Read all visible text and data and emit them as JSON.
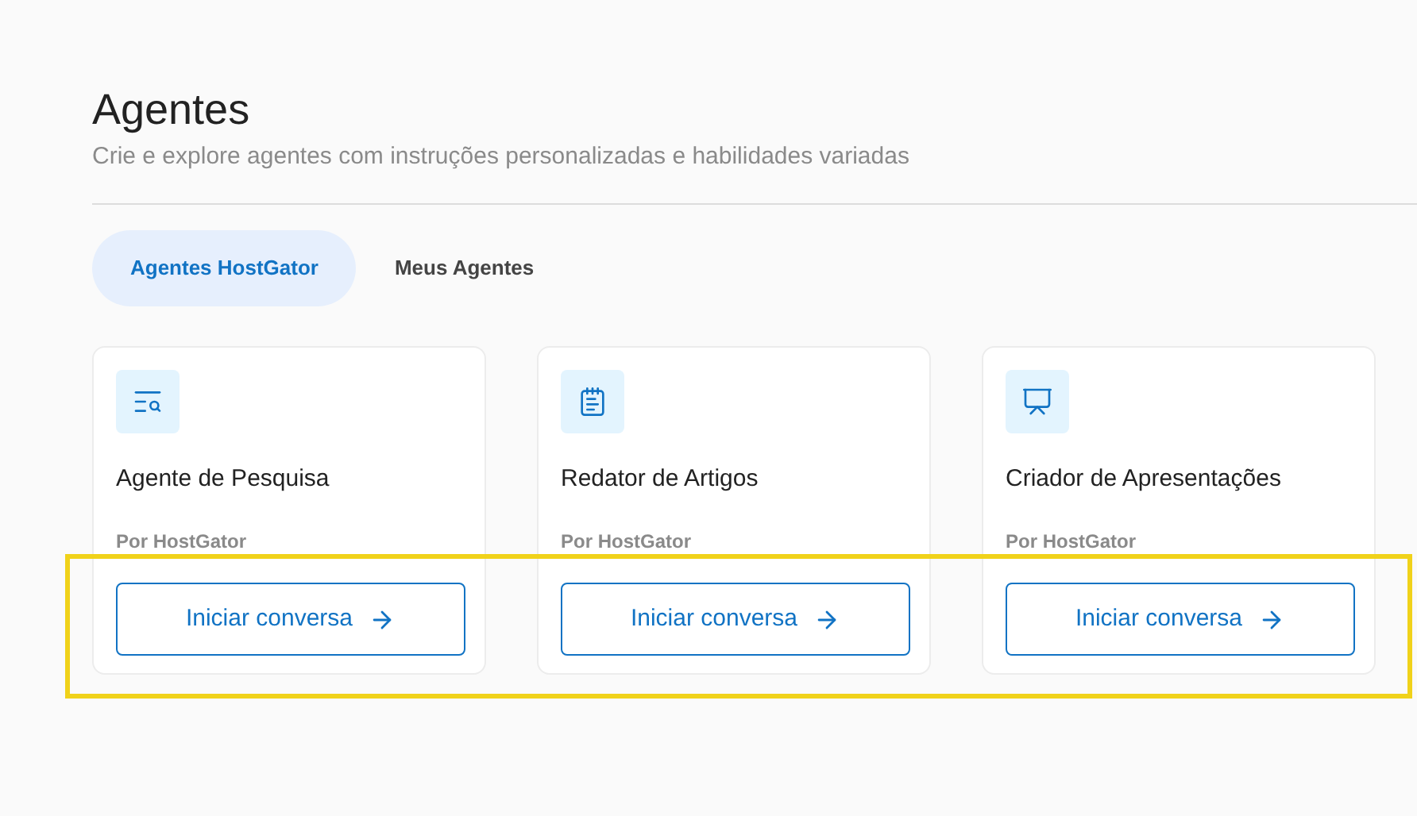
{
  "header": {
    "title": "Agentes",
    "subtitle": "Crie e explore agentes com instruções personalizadas e habilidades variadas"
  },
  "tabs": [
    {
      "label": "Agentes HostGator",
      "selected": true
    },
    {
      "label": "Meus Agentes",
      "selected": false
    }
  ],
  "cards": [
    {
      "kind": "search",
      "title": "Agente de Pesquisa",
      "author": "Por HostGator",
      "button": "Iniciar conversa"
    },
    {
      "kind": "document",
      "title": "Redator de Artigos",
      "author": "Por HostGator",
      "button": "Iniciar conversa"
    },
    {
      "kind": "presentation",
      "title": "Criador de Apresentações",
      "author": "Por HostGator",
      "button": "Iniciar conversa"
    }
  ],
  "annotation": {
    "kind": "frame"
  }
}
